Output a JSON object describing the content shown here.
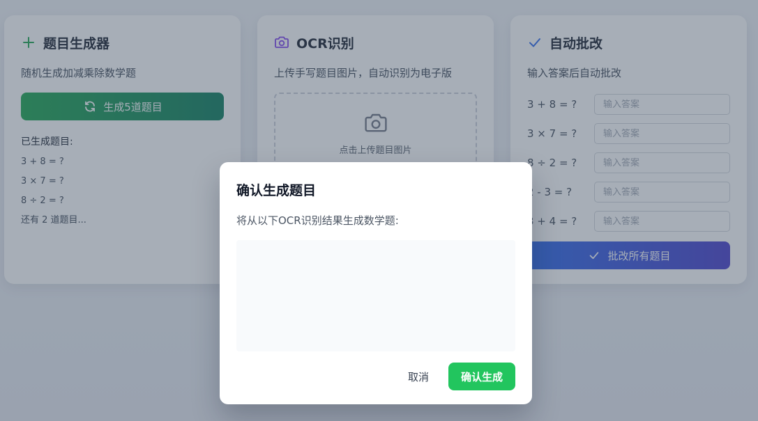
{
  "generator": {
    "title": "题目生成器",
    "description": "随机生成加减乘除数学题",
    "button_label": "生成5道题目",
    "generated_label": "已生成题目:",
    "questions": [
      "3 + 8 = ?",
      "3 × 7 = ?",
      "8 ÷ 2 = ?"
    ],
    "more_text": "还有 2 道题目..."
  },
  "ocr": {
    "title": "OCR识别",
    "description": "上传手写题目图片，自动识别为电子版",
    "upload_text": "点击上传题目图片"
  },
  "grading": {
    "title": "自动批改",
    "description": "输入答案后自动批改",
    "rows": [
      {
        "question": "3 + 8 = ?",
        "placeholder": "输入答案"
      },
      {
        "question": "3 × 7 = ?",
        "placeholder": "输入答案"
      },
      {
        "question": "8 ÷ 2 = ?",
        "placeholder": "输入答案"
      },
      {
        "question": "2 - 3 = ?",
        "placeholder": "输入答案"
      },
      {
        "question": "3 + 4 = ?",
        "placeholder": "输入答案"
      }
    ],
    "button_label": "批改所有题目"
  },
  "modal": {
    "title": "确认生成题目",
    "description": "将从以下OCR识别结果生成数学题:",
    "ocr_result": "",
    "cancel_label": "取消",
    "confirm_label": "确认生成"
  },
  "colors": {
    "generator_accent": "#16a34a",
    "ocr_accent": "#7c3aed",
    "grading_accent": "#2563eb",
    "confirm_button": "#22c55e"
  },
  "icons": {
    "generator": "plus-icon",
    "generate_button": "refresh-icon",
    "ocr": "camera-icon",
    "grading": "check-icon",
    "grade_button": "check-icon"
  }
}
